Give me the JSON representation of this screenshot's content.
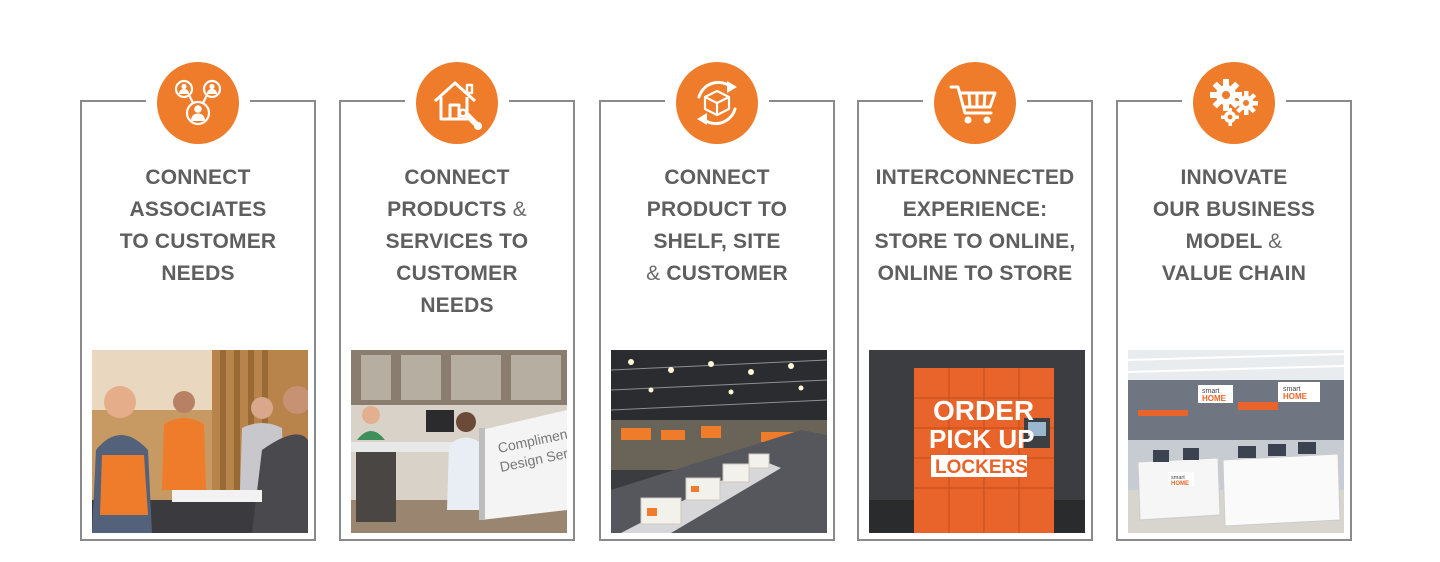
{
  "pillars": [
    {
      "icon": "network-people-icon",
      "lines": [
        {
          "pre": "CONNECT",
          "amp": "",
          "post": ""
        },
        {
          "pre": "ASSOCIATES",
          "amp": "",
          "post": ""
        },
        {
          "pre": "TO CUSTOMER",
          "amp": "",
          "post": ""
        },
        {
          "pre": "NEEDS",
          "amp": "",
          "post": ""
        }
      ]
    },
    {
      "icon": "house-wrench-icon",
      "lines": [
        {
          "pre": "CONNECT",
          "amp": "",
          "post": ""
        },
        {
          "pre": "PRODUCTS ",
          "amp": "&",
          "post": ""
        },
        {
          "pre": "SERVICES TO",
          "amp": "",
          "post": ""
        },
        {
          "pre": "CUSTOMER",
          "amp": "",
          "post": ""
        },
        {
          "pre": "NEEDS",
          "amp": "",
          "post": ""
        }
      ]
    },
    {
      "icon": "box-cycle-icon",
      "lines": [
        {
          "pre": "CONNECT",
          "amp": "",
          "post": ""
        },
        {
          "pre": "PRODUCT TO",
          "amp": "",
          "post": ""
        },
        {
          "pre": "SHELF, SITE",
          "amp": "",
          "post": ""
        },
        {
          "pre": "",
          "amp": "&",
          "post": " CUSTOMER"
        }
      ]
    },
    {
      "icon": "shopping-cart-icon",
      "lines": [
        {
          "pre": "INTERCONNECTED",
          "amp": "",
          "post": ""
        },
        {
          "pre": "EXPERIENCE:",
          "amp": "",
          "post": ""
        },
        {
          "pre": "STORE TO ONLINE,",
          "amp": "",
          "post": ""
        },
        {
          "pre": "ONLINE TO STORE",
          "amp": "",
          "post": ""
        }
      ]
    },
    {
      "icon": "gears-icon",
      "lines": [
        {
          "pre": "INNOVATE",
          "amp": "",
          "post": ""
        },
        {
          "pre": "OUR BUSINESS",
          "amp": "",
          "post": ""
        },
        {
          "pre": "MODEL ",
          "amp": "&",
          "post": ""
        },
        {
          "pre": "VALUE CHAIN",
          "amp": "",
          "post": ""
        }
      ]
    }
  ],
  "photo_text": {
    "design_sign": [
      "Complimentary",
      "Design Services"
    ],
    "locker_sign": [
      "ORDER",
      "PICK UP",
      "LOCKERS"
    ],
    "smart_home": [
      "smart",
      "HOME"
    ]
  },
  "colors": {
    "accent": "#ee7c2a",
    "text": "#5e5e5e",
    "border": "#8a8a8a"
  }
}
